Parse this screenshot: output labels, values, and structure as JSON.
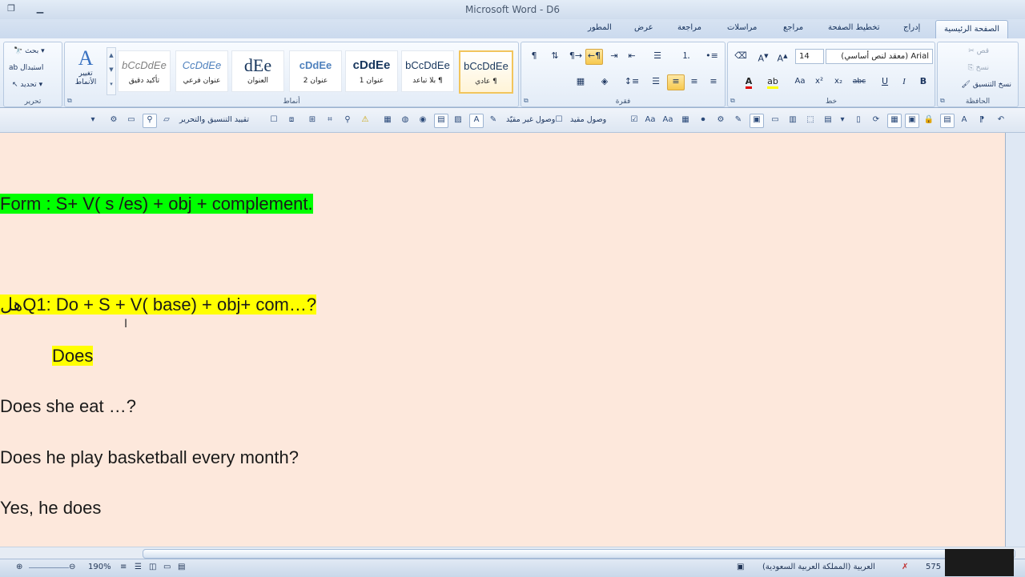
{
  "app": {
    "title": "Microsoft Word - D6"
  },
  "tabs": [
    "الصفحة الرئيسية",
    "إدراج",
    "تخطيط الصفحة",
    "مراجع",
    "مراسلات",
    "مراجعة",
    "عرض",
    "المطور"
  ],
  "clipboard": {
    "label": "الحافظة",
    "cut": "قص",
    "copy": "نسخ",
    "format_painter": "نسخ التنسيق"
  },
  "font": {
    "label": "خط",
    "name": "Arial (معقد لنص أساسي)",
    "size": "14"
  },
  "paragraph": {
    "label": "فقرة"
  },
  "styles": {
    "label": "أنماط",
    "items": [
      {
        "sample": "bCcDdEe",
        "name": "¶ عادي",
        "selected": true
      },
      {
        "sample": "bCcDdEe",
        "name": "¶ بلا تباعد"
      },
      {
        "sample": "cDdEe",
        "name": "عنوان 1"
      },
      {
        "sample": "cDdEe",
        "name": "عنوان 2"
      },
      {
        "sample": "dEe",
        "name": "العنوان"
      },
      {
        "sample": "CcDdEe",
        "name": "عنوان فرعي"
      },
      {
        "sample": "bCcDdEe",
        "name": "تأكيد دقيق"
      }
    ],
    "change_label": "تغيير الأنماط"
  },
  "editing": {
    "label": "تحرير",
    "find": "بحث",
    "replace": "استبدال",
    "select": "تحديد"
  },
  "toolbar": {
    "restrict_label": "تقييد التنسيق والتحرير",
    "unrestricted_access": "وصول غير مقيّد",
    "restricted_access": "وصول مقيد"
  },
  "document": {
    "lines": [
      "Form : S+ V( s /es) + obj + complement.",
      "هلQ1: Do  + S + V( base) + obj+ com…?",
      "Does",
      "Does she eat …?",
      "Does he play basketball every month?",
      "Yes, he does"
    ],
    "highlight_colors": {
      "green": "#00ff00",
      "yellow": "#ffff00"
    },
    "page_color": "#fde8dc"
  },
  "status": {
    "words": "575",
    "language": "العربية (المملكة العربية السعودية)",
    "zoom": "190%"
  }
}
